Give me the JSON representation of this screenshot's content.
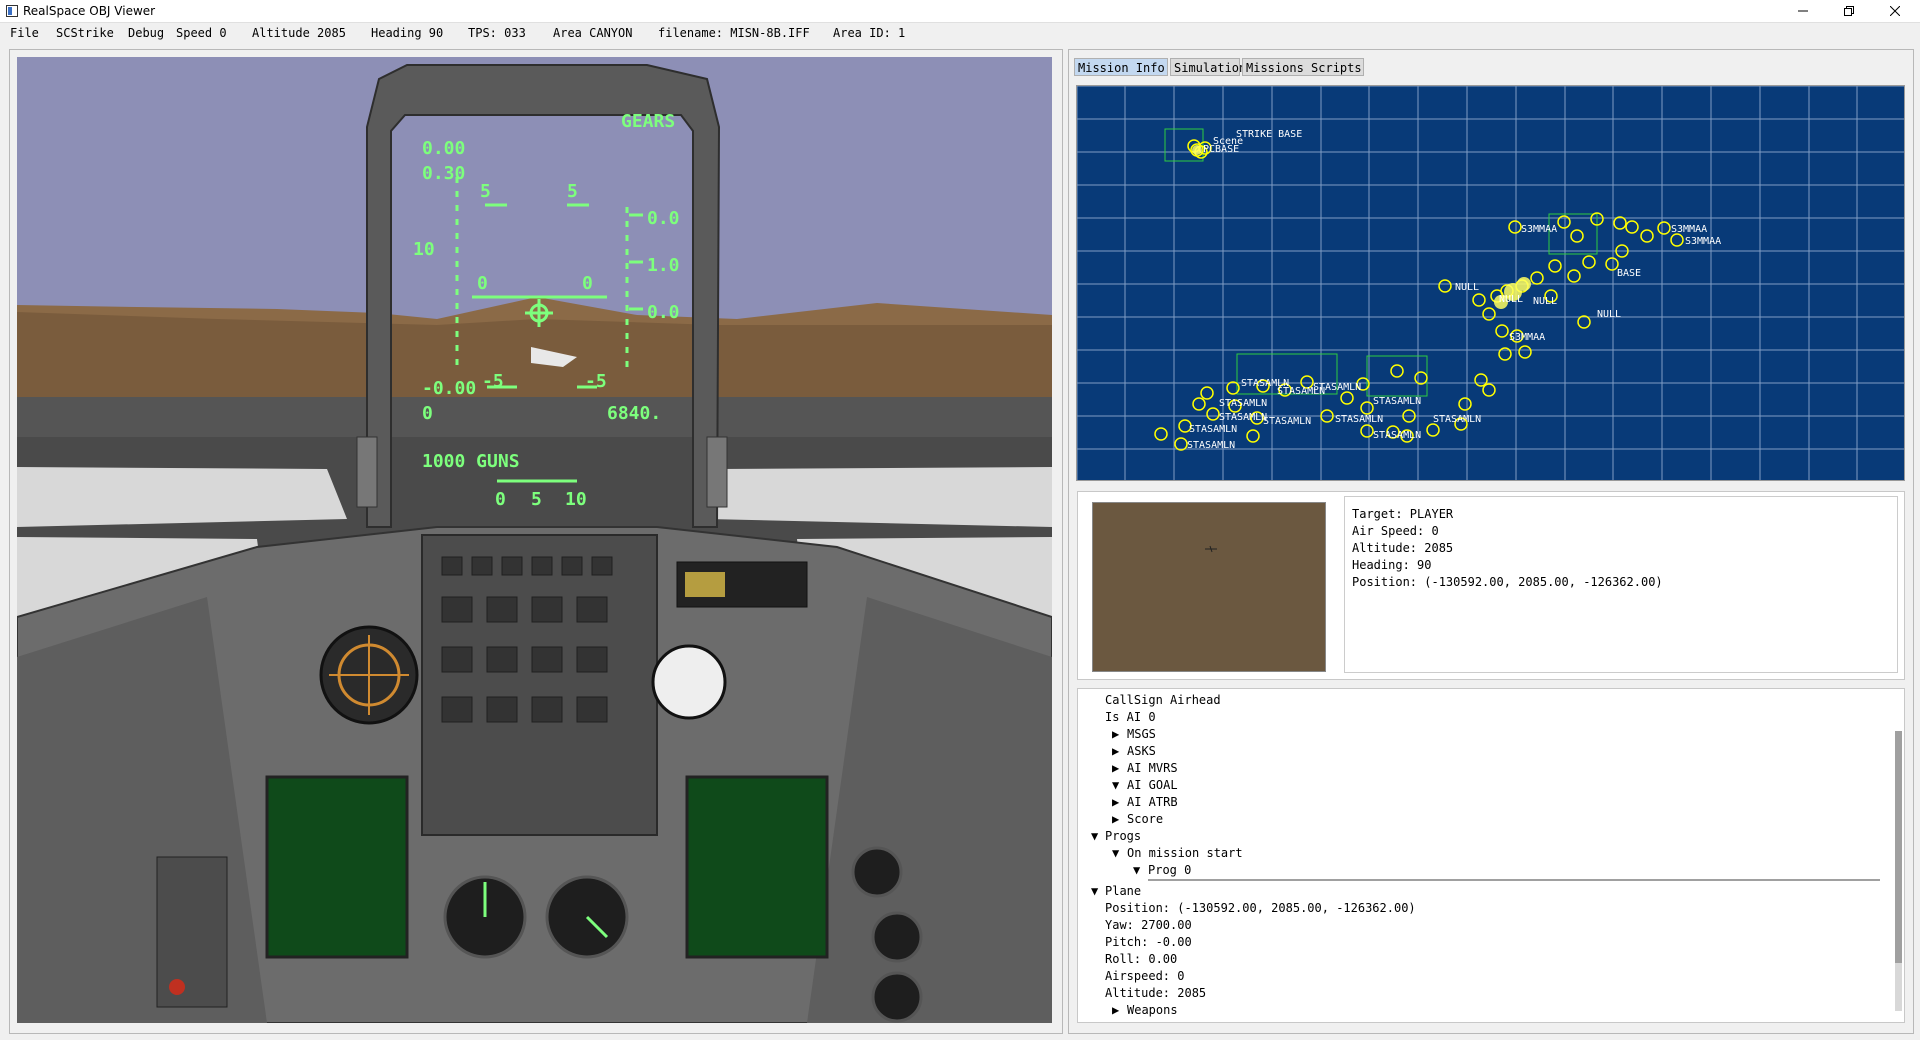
{
  "window": {
    "title": "RealSpace OBJ Viewer",
    "controls": [
      "minimize-icon",
      "restore-icon",
      "close-icon"
    ]
  },
  "menubar": {
    "file": "File",
    "scstrike": "SCStrike",
    "debug": "Debug",
    "speed": "Speed 0",
    "altitude": "Altitude 2085",
    "heading": "Heading 90",
    "tps": "TPS: 033",
    "area": "Area CANYON",
    "filename": "filename: MISN-8B.IFF",
    "area_id": "Area ID: 1"
  },
  "hud": {
    "gears": "GEARS",
    "line1": "0.00",
    "line2": "0.30",
    "pitch_left": "10",
    "tick_top_left": "5",
    "tick_top_right": "5",
    "scale_a": "0.0",
    "scale_b": "1.0",
    "scale_c": "0.0",
    "center_left": "0",
    "center_right": "0",
    "vs_left": "-0.00",
    "vs_mid": "-5",
    "vs_right": "-5",
    "zero": "0",
    "altitude_read": "6840.",
    "guns": "1000 GUNS",
    "bottom_a": "0",
    "bottom_b": "5",
    "bottom_c": "10"
  },
  "colors": {
    "hud_green": "#7dff7d",
    "map_bg": "#083a78",
    "map_grid": "#9fb5d8",
    "marker_yellow": "#ffff00",
    "marker_green": "#2ecc40",
    "sky": "#8d8fb6",
    "ground": "#8b6a47"
  },
  "tabs": [
    {
      "label": "Mission Info",
      "active": true
    },
    {
      "label": "Simulation",
      "active": false
    },
    {
      "label": "Missions Scripts",
      "active": false
    }
  ],
  "map": {
    "labels": [
      "Scene",
      "STRIKE BASE",
      "PCBASE",
      "NULL",
      "NULL",
      "NULL",
      "NULL",
      "BASE",
      "STASAMLN",
      "STASAMLN",
      "STASAMLN",
      "STASAMLN",
      "STASAMLN",
      "STASAMLN",
      "STASAMLN",
      "STASAMLN",
      "STASAMLN",
      "STASAMLN",
      "STASAMLN",
      "STASAMLN",
      "S3MMAA",
      "S3MMAA",
      "S3MMAA",
      "S3MMAA"
    ]
  },
  "target_info": {
    "target": "Target: PLAYER",
    "air_speed": "Air Speed: 0",
    "altitude": "Altitude: 2085",
    "heading": "Heading: 90",
    "position": "Position: (-130592.00, 2085.00, -126362.00)"
  },
  "tree": {
    "callsign": "CallSign Airhead",
    "is_ai": "Is AI 0",
    "msgs": "MSGS",
    "asks": "ASKS",
    "ai_mvrs": "AI MVRS",
    "ai_goal": "AI GOAL",
    "ai_atrb": "AI ATRB",
    "score": "Score",
    "progs": "Progs",
    "on_mission_start": "On mission start",
    "prog0": "Prog 0",
    "plane": "Plane",
    "position": "Position: (-130592.00, 2085.00, -126362.00)",
    "yaw": "Yaw: 2700.00",
    "pitch": "Pitch: -0.00",
    "roll": "Roll: 0.00",
    "airspeed": "Airspeed: 0",
    "altitude": "Altitude: 2085",
    "weapons": "Weapons"
  }
}
